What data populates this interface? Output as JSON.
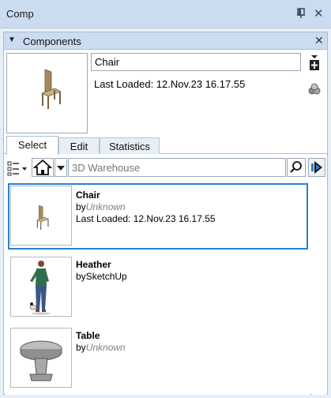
{
  "window": {
    "title": "Comp"
  },
  "section": {
    "title": "Components"
  },
  "component": {
    "name": "Chair",
    "description": "Last Loaded: 12.Nov.23 16.17.55"
  },
  "tabs": [
    {
      "label": "Select",
      "active": true
    },
    {
      "label": "Edit",
      "active": false
    },
    {
      "label": "Statistics",
      "active": false
    }
  ],
  "search": {
    "placeholder": "3D Warehouse"
  },
  "items": [
    {
      "name": "Chair",
      "by_prefix": "by",
      "author": "Unknown",
      "author_unknown": true,
      "loaded": "Last Loaded: 12.Nov.23 16.17.55",
      "selected": true,
      "icon": "chair-icon"
    },
    {
      "name": "Heather",
      "by_prefix": "by",
      "author": "SketchUp",
      "author_unknown": false,
      "loaded": "",
      "selected": false,
      "icon": "person-icon"
    },
    {
      "name": "Table",
      "by_prefix": "by",
      "author": "Unknown",
      "author_unknown": true,
      "loaded": "",
      "selected": false,
      "icon": "table-icon"
    }
  ],
  "colors": {
    "accent": "#2a7fd0",
    "header_bg": "#cbdcf0",
    "panel_border": "#a9bdd3"
  }
}
